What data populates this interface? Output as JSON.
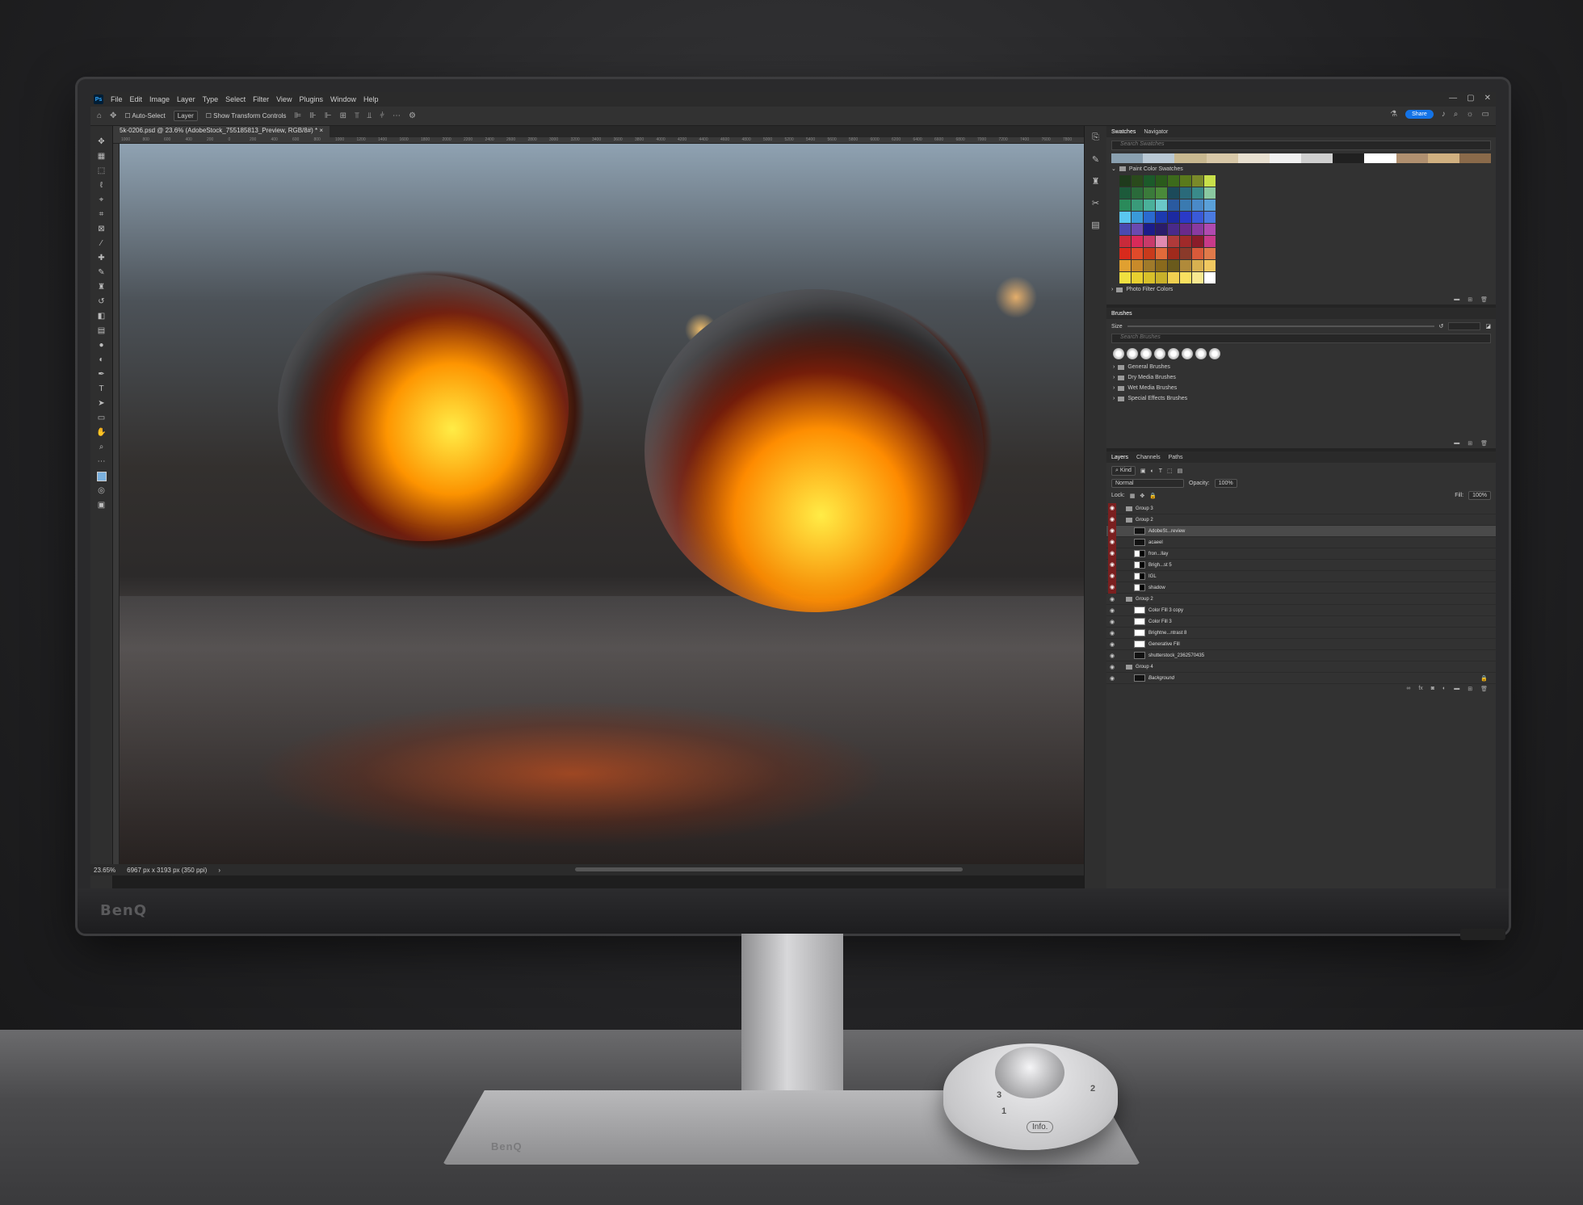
{
  "app": {
    "logo_text": "Ps",
    "menu": [
      "File",
      "Edit",
      "Image",
      "Layer",
      "Type",
      "Select",
      "Filter",
      "View",
      "Plugins",
      "Window",
      "Help"
    ],
    "window_controls": [
      "—",
      "▢",
      "✕"
    ]
  },
  "options_bar": {
    "auto_select_label": "Auto-Select",
    "auto_select_value": "Layer",
    "transform_label": "Show Transform Controls",
    "share_label": "Share"
  },
  "document": {
    "tab_title": "5k-0206.psd @ 23.6% (AdobeStock_755185813_Preview, RGB/8#) *",
    "zoom": "23.65%",
    "dimensions": "6967 px x 3193 px (350 ppi)"
  },
  "ruler_ticks": [
    "1000",
    "800",
    "600",
    "400",
    "200",
    "0",
    "200",
    "400",
    "600",
    "800",
    "1000",
    "1200",
    "1400",
    "1600",
    "1800",
    "2000",
    "2200",
    "2400",
    "2600",
    "2800",
    "3000",
    "3200",
    "3400",
    "3600",
    "3800",
    "4000",
    "4200",
    "4400",
    "4600",
    "4800",
    "5000",
    "5200",
    "5400",
    "5600",
    "5800",
    "6000",
    "6200",
    "6400",
    "6600",
    "6800",
    "7000",
    "7200",
    "7400",
    "7600",
    "7800"
  ],
  "swatches_panel": {
    "tabs": [
      "Swatches",
      "Navigator"
    ],
    "search_placeholder": "Search Swatches",
    "group_name": "Paint Color Swatches",
    "group2_name": "Photo Filter Colors",
    "recent_colors": [
      "#8aa0b0",
      "#b9c8d4",
      "#c8b890",
      "#d8c8a8",
      "#e8e0d0",
      "#f0f0f0",
      "#cfcfcf",
      "#202020",
      "#ffffff",
      "#b09070",
      "#d0b080",
      "#8a6a4a"
    ],
    "colors": [
      "#1f3a1c",
      "#2a4a1c",
      "#1c5a2a",
      "#2a5a1c",
      "#3c6a1c",
      "#5a7a1c",
      "#7a8a2a",
      "#c8e04a",
      "#1c5a3a",
      "#2a6a3a",
      "#3a7a3a",
      "#4a8a3a",
      "#1c4a5a",
      "#2a6a7a",
      "#3a8a8a",
      "#8ac8a0",
      "#2a8a5a",
      "#3a9a7a",
      "#4ab09a",
      "#6ac8c8",
      "#2a5aa0",
      "#3a7ab0",
      "#4a8ac8",
      "#5aa0d8",
      "#5ac8f0",
      "#3a9ad8",
      "#2a6ad0",
      "#1c3ab0",
      "#1c2aa0",
      "#2a3ac8",
      "#3a5ad8",
      "#4a7ae0",
      "#4a4ab0",
      "#6a4ab0",
      "#1c1c8a",
      "#2a1c6a",
      "#4a2a8a",
      "#6a2a8a",
      "#8a3aa0",
      "#b04ab0",
      "#c82a3a",
      "#d82a5a",
      "#c83a6a",
      "#e08ab0",
      "#b03a3a",
      "#a02a2a",
      "#8a1c2a",
      "#c83a8a",
      "#d82a1c",
      "#e04a2a",
      "#c83a1c",
      "#e06a3a",
      "#a02a1c",
      "#8a3a2a",
      "#d85a3a",
      "#e07a4a",
      "#e0a030",
      "#c88a2a",
      "#a07a2a",
      "#8a6a1c",
      "#6a5a1c",
      "#b08a3a",
      "#d8b050",
      "#f0c860",
      "#f0e040",
      "#e8d030",
      "#d8c02a",
      "#c8b02a",
      "#f0d050",
      "#f8e060",
      "#f8e890",
      "#ffffff"
    ]
  },
  "brushes_panel": {
    "title": "Brushes",
    "size_label": "Size",
    "search_placeholder": "Search Brushes",
    "folders": [
      "General Brushes",
      "Dry Media Brushes",
      "Wet Media Brushes",
      "Special Effects Brushes"
    ]
  },
  "layers_panel": {
    "tabs": [
      "Layers",
      "Channels",
      "Paths"
    ],
    "kind_label": "Kind",
    "blend_mode": "Normal",
    "opacity_label": "Opacity:",
    "opacity_value": "100%",
    "lock_label": "Lock:",
    "fill_label": "Fill:",
    "fill_value": "100%",
    "layers": [
      {
        "name": "Group 3",
        "type": "group",
        "red": true
      },
      {
        "name": "Group 2",
        "type": "group",
        "red": true
      },
      {
        "name": "AdobeSt...review",
        "type": "image",
        "red": true,
        "selected": true
      },
      {
        "name": "acaeel",
        "type": "image",
        "red": true
      },
      {
        "name": "fron...llay",
        "type": "mask",
        "red": true
      },
      {
        "name": "Brigh...st 5",
        "type": "mask",
        "red": true
      },
      {
        "name": "IGL",
        "type": "mask",
        "red": true
      },
      {
        "name": "shadow",
        "type": "mask",
        "red": true
      },
      {
        "name": "Group 2",
        "type": "group",
        "red": false
      },
      {
        "name": "Color Fill 3 copy",
        "type": "fill",
        "red": false
      },
      {
        "name": "Color Fill 3",
        "type": "fill",
        "red": false
      },
      {
        "name": "Brightne...ntrast 8",
        "type": "fill",
        "red": false
      },
      {
        "name": "Generative Fill",
        "type": "fill",
        "red": false
      },
      {
        "name": "shutterstock_2362570435",
        "type": "image",
        "red": false
      },
      {
        "name": "Group 4",
        "type": "group",
        "red": false
      },
      {
        "name": "Background",
        "type": "bg",
        "red": false
      }
    ]
  },
  "hardware": {
    "monitor_brand": "BenQ",
    "base_brand": "BenQ",
    "puck_labels": [
      "1",
      "2",
      "3"
    ],
    "puck_info": "Info."
  },
  "colors": {
    "ps_bg": "#323232",
    "share_blue": "#1473e6",
    "visibility_red": "#7a1f1f"
  }
}
